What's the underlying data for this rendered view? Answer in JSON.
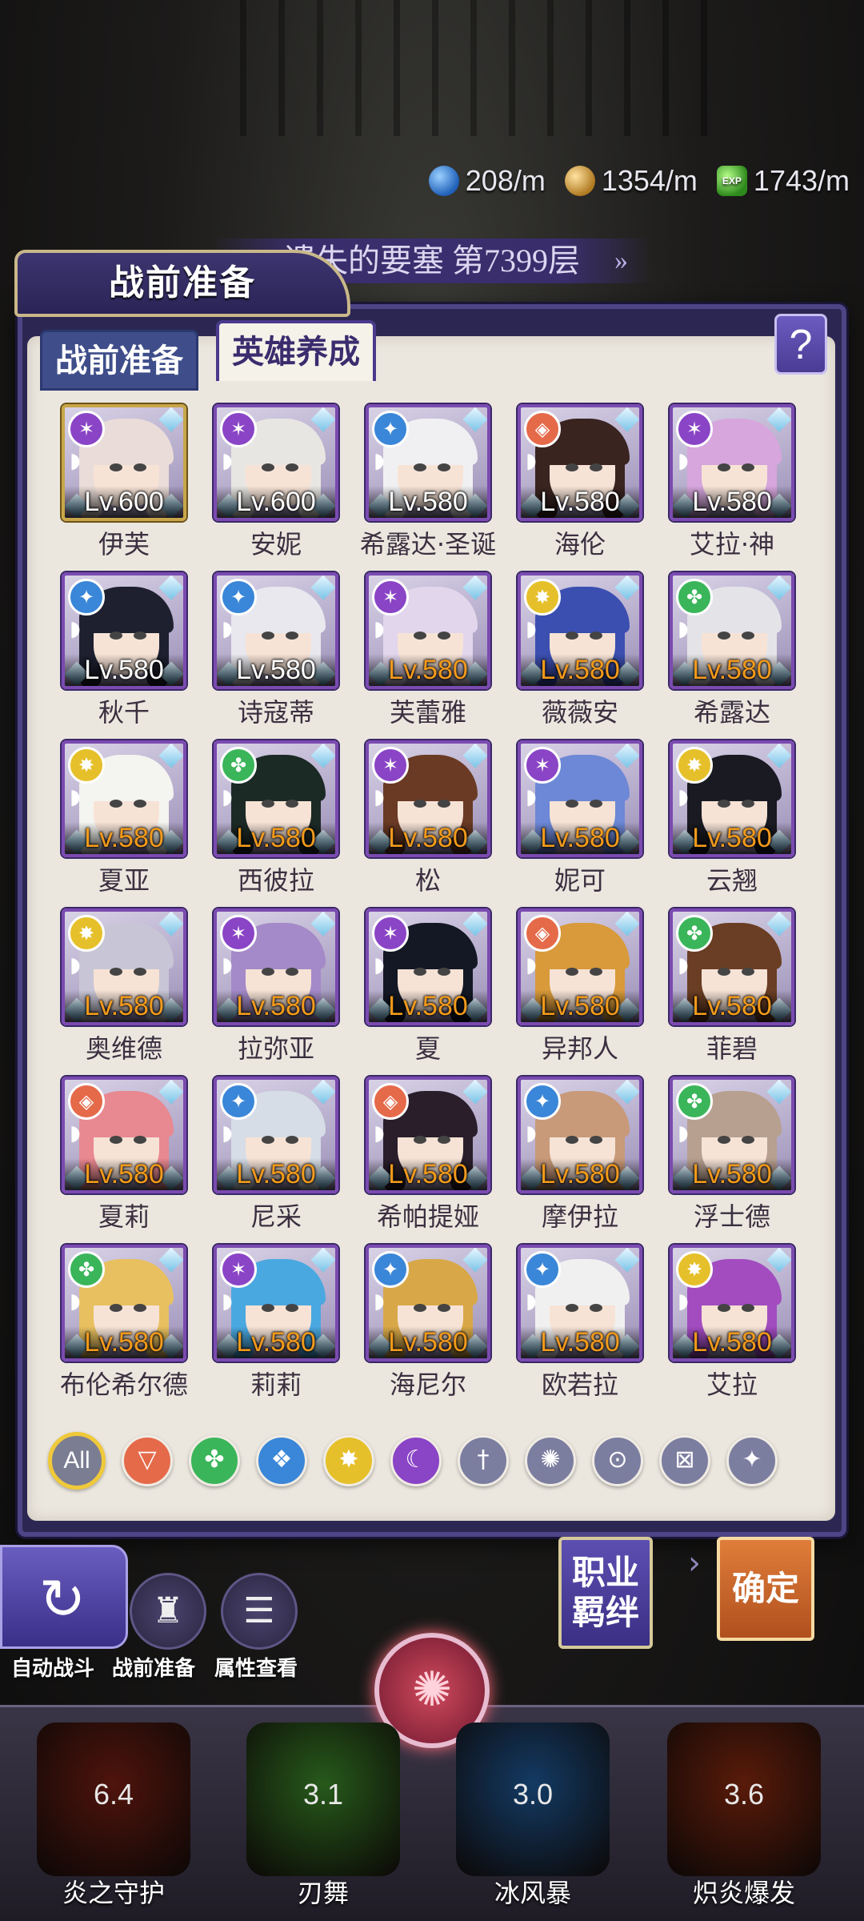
{
  "resources": [
    {
      "icon": "gem-icon",
      "value": "208/m"
    },
    {
      "icon": "coin-icon",
      "value": "1354/m"
    },
    {
      "icon": "exp-icon",
      "label": "EXP",
      "value": "1743/m"
    }
  ],
  "stage": {
    "title": "遗失的要塞 第7399层"
  },
  "panel": {
    "title": "战前准备",
    "tabs": [
      {
        "label": "战前准备",
        "active": false
      },
      {
        "label": "英雄养成",
        "active": true
      }
    ],
    "help": "?"
  },
  "heroes": [
    {
      "name": "伊芙",
      "level": "Lv.600",
      "lv_color": "white",
      "element": "purple",
      "hair": "#eadcd8",
      "frame": "gold"
    },
    {
      "name": "安妮",
      "level": "Lv.600",
      "lv_color": "white",
      "element": "purple",
      "hair": "#e8e6e2",
      "frame": "purple"
    },
    {
      "name": "希露达·圣诞",
      "level": "Lv.580",
      "lv_color": "white",
      "element": "blue",
      "hair": "#f0f0f2",
      "frame": "purple"
    },
    {
      "name": "海伦",
      "level": "Lv.580",
      "lv_color": "white",
      "element": "red",
      "hair": "#3a2420",
      "frame": "purple"
    },
    {
      "name": "艾拉·神",
      "level": "Lv.580",
      "lv_color": "white",
      "element": "purple",
      "hair": "#d6a6dc",
      "frame": "purple"
    },
    {
      "name": "秋千",
      "level": "Lv.580",
      "lv_color": "white",
      "element": "blue",
      "hair": "#1e2030",
      "frame": "purple"
    },
    {
      "name": "诗寇蒂",
      "level": "Lv.580",
      "lv_color": "white",
      "element": "blue",
      "hair": "#e8e8ee",
      "frame": "purple"
    },
    {
      "name": "芙蕾雅",
      "level": "Lv.580",
      "lv_color": "orange",
      "element": "purple",
      "hair": "#e2d6ec",
      "frame": "purple"
    },
    {
      "name": "薇薇安",
      "level": "Lv.580",
      "lv_color": "orange",
      "element": "yellow",
      "hair": "#3b4fb0",
      "frame": "purple"
    },
    {
      "name": "希露达",
      "level": "Lv.580",
      "lv_color": "orange",
      "element": "green",
      "hair": "#e4e4e8",
      "frame": "purple"
    },
    {
      "name": "夏亚",
      "level": "Lv.580",
      "lv_color": "orange",
      "element": "yellow",
      "hair": "#f4f4f0",
      "frame": "purple"
    },
    {
      "name": "西彼拉",
      "level": "Lv.580",
      "lv_color": "orange",
      "element": "green",
      "hair": "#1c2a26",
      "frame": "purple"
    },
    {
      "name": "松",
      "level": "Lv.580",
      "lv_color": "orange",
      "element": "purple",
      "hair": "#6a3a24",
      "frame": "purple"
    },
    {
      "name": "妮可",
      "level": "Lv.580",
      "lv_color": "orange",
      "element": "purple",
      "hair": "#6c88d6",
      "frame": "purple"
    },
    {
      "name": "云翘",
      "level": "Lv.580",
      "lv_color": "orange",
      "element": "yellow",
      "hair": "#1a1a22",
      "frame": "purple"
    },
    {
      "name": "奥维德",
      "level": "Lv.580",
      "lv_color": "orange",
      "element": "yellow",
      "hair": "#c8c6d6",
      "frame": "purple"
    },
    {
      "name": "拉弥亚",
      "level": "Lv.580",
      "lv_color": "orange",
      "element": "purple",
      "hair": "#a48ac8",
      "frame": "purple"
    },
    {
      "name": "夏",
      "level": "Lv.580",
      "lv_color": "orange",
      "element": "purple",
      "hair": "#141824",
      "frame": "purple"
    },
    {
      "name": "异邦人",
      "level": "Lv.580",
      "lv_color": "orange",
      "element": "red",
      "hair": "#d89a3a",
      "frame": "purple"
    },
    {
      "name": "菲碧",
      "level": "Lv.580",
      "lv_color": "orange",
      "element": "green",
      "hair": "#6a3e24",
      "frame": "purple"
    },
    {
      "name": "夏莉",
      "level": "Lv.580",
      "lv_color": "orange",
      "element": "red",
      "hair": "#e88890",
      "frame": "purple"
    },
    {
      "name": "尼采",
      "level": "Lv.580",
      "lv_color": "orange",
      "element": "blue",
      "hair": "#d6dde6",
      "frame": "purple"
    },
    {
      "name": "希帕提娅",
      "level": "Lv.580",
      "lv_color": "orange",
      "element": "red",
      "hair": "#2a1e2a",
      "frame": "purple"
    },
    {
      "name": "摩伊拉",
      "level": "Lv.580",
      "lv_color": "orange",
      "element": "blue",
      "hair": "#c89a7a",
      "frame": "purple"
    },
    {
      "name": "浮士德",
      "level": "Lv.580",
      "lv_color": "orange",
      "element": "green",
      "hair": "#b8a090",
      "frame": "purple"
    },
    {
      "name": "布伦希尔德",
      "level": "Lv.580",
      "lv_color": "orange",
      "element": "green",
      "hair": "#e8c060",
      "frame": "purple"
    },
    {
      "name": "莉莉",
      "level": "Lv.580",
      "lv_color": "orange",
      "element": "purple",
      "hair": "#4aa8e0",
      "frame": "purple"
    },
    {
      "name": "海尼尔",
      "level": "Lv.580",
      "lv_color": "orange",
      "element": "blue",
      "hair": "#d8a848",
      "frame": "purple"
    },
    {
      "name": "欧若拉",
      "level": "Lv.580",
      "lv_color": "orange",
      "element": "blue",
      "hair": "#f0f0f0",
      "frame": "purple"
    },
    {
      "name": "艾拉",
      "level": "Lv.580",
      "lv_color": "orange",
      "element": "yellow",
      "hair": "#a24cc0",
      "frame": "purple"
    }
  ],
  "filters": [
    {
      "label": "All",
      "style": "all"
    },
    {
      "icon": "fire-element-icon",
      "style": "red"
    },
    {
      "icon": "wind-element-icon",
      "style": "green"
    },
    {
      "icon": "water-element-icon",
      "style": "blue"
    },
    {
      "icon": "light-element-icon",
      "style": "yellow"
    },
    {
      "icon": "dark-element-icon",
      "style": "purple"
    },
    {
      "icon": "warrior-class-icon",
      "style": "gray"
    },
    {
      "icon": "mage-class-icon",
      "style": "gray"
    },
    {
      "icon": "support-class-icon",
      "style": "gray"
    },
    {
      "icon": "ranger-class-icon",
      "style": "gray"
    },
    {
      "icon": "guardian-class-icon",
      "style": "gray"
    }
  ],
  "buttons": {
    "job_bond": "职业\n羁绊",
    "confirm": "确定"
  },
  "bottom_menu": [
    {
      "label": "自动战斗",
      "icon": "auto-battle-icon"
    },
    {
      "label": "战前准备",
      "icon": "pre-battle-icon"
    },
    {
      "label": "属性查看",
      "icon": "attributes-icon"
    }
  ],
  "skills": [
    {
      "name": "炎之守护",
      "cooldown": "6.4",
      "color": "#7a1f14"
    },
    {
      "name": "刃舞",
      "cooldown": "3.1",
      "color": "#3c8a2a"
    },
    {
      "name": "冰风暴",
      "cooldown": "3.0",
      "color": "#1f5a9a"
    },
    {
      "name": "炽炎爆发",
      "cooldown": "3.6",
      "color": "#8a2a10"
    }
  ],
  "colors": {
    "red": "#e56a4a",
    "green": "#3bb55a",
    "blue": "#3a86d8",
    "yellow": "#e6c02a",
    "purple": "#8a44c6",
    "gray": "#7c7ea0"
  }
}
